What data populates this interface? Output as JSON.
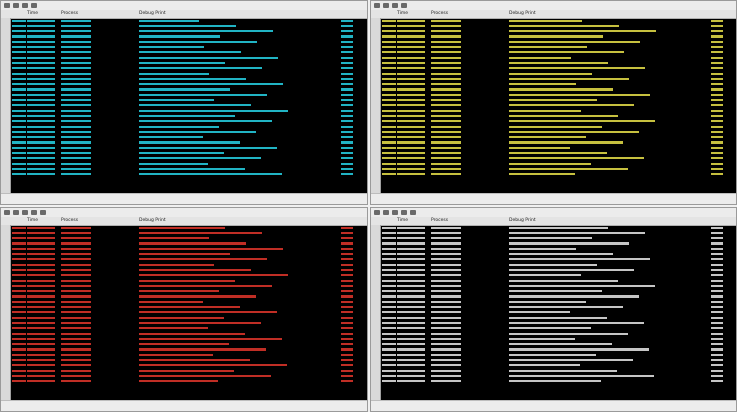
{
  "panes": [
    {
      "id": "tl",
      "color": "#27d3e6",
      "header": [
        "",
        "Time",
        "Process",
        "Debug Print"
      ],
      "status": [
        "",
        "",
        ""
      ],
      "rows": 30
    },
    {
      "id": "tr",
      "color": "#e9e24a",
      "header": [
        "",
        "Time",
        "Process",
        "Debug Print"
      ],
      "status": [
        "",
        ""
      ],
      "rows": 30
    },
    {
      "id": "bl",
      "color": "#e2362c",
      "header": [
        "",
        "Time",
        "Process",
        "Debug Print"
      ],
      "status": [
        "",
        ""
      ],
      "rows": 30
    },
    {
      "id": "br",
      "color": "#e8e8e8",
      "header": [
        "",
        "Time",
        "Process",
        "Debug Print"
      ],
      "status": [
        "",
        ""
      ],
      "rows": 30
    }
  ]
}
